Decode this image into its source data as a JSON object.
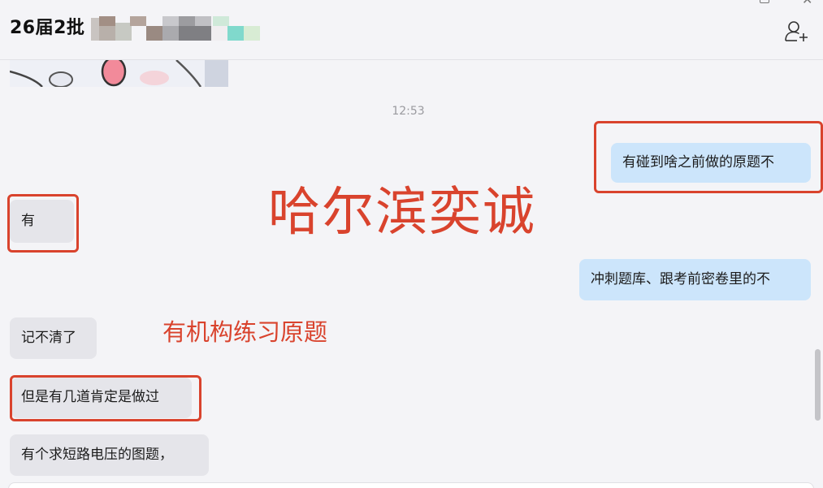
{
  "header": {
    "title": "26届2批",
    "add_member_icon": "add-user-icon"
  },
  "messages": {
    "timestamp": "12:53",
    "out_1": "有碰到啥之前做的原题不",
    "in_1": "有",
    "out_2": "冲刺题库、跟考前密卷里的不",
    "in_2": "记不清了",
    "in_3": "但是有几道肯定是做过",
    "in_4": "有个求短路电压的图题，"
  },
  "annotations": {
    "big_text": "哈尔滨奕诚",
    "small_text": "有机构练习原题"
  },
  "colors": {
    "annotation_red": "#d9432d",
    "outgoing_bubble": "#cce5fb",
    "incoming_bubble": "#e5e5ea",
    "background": "#f4f4f7"
  }
}
